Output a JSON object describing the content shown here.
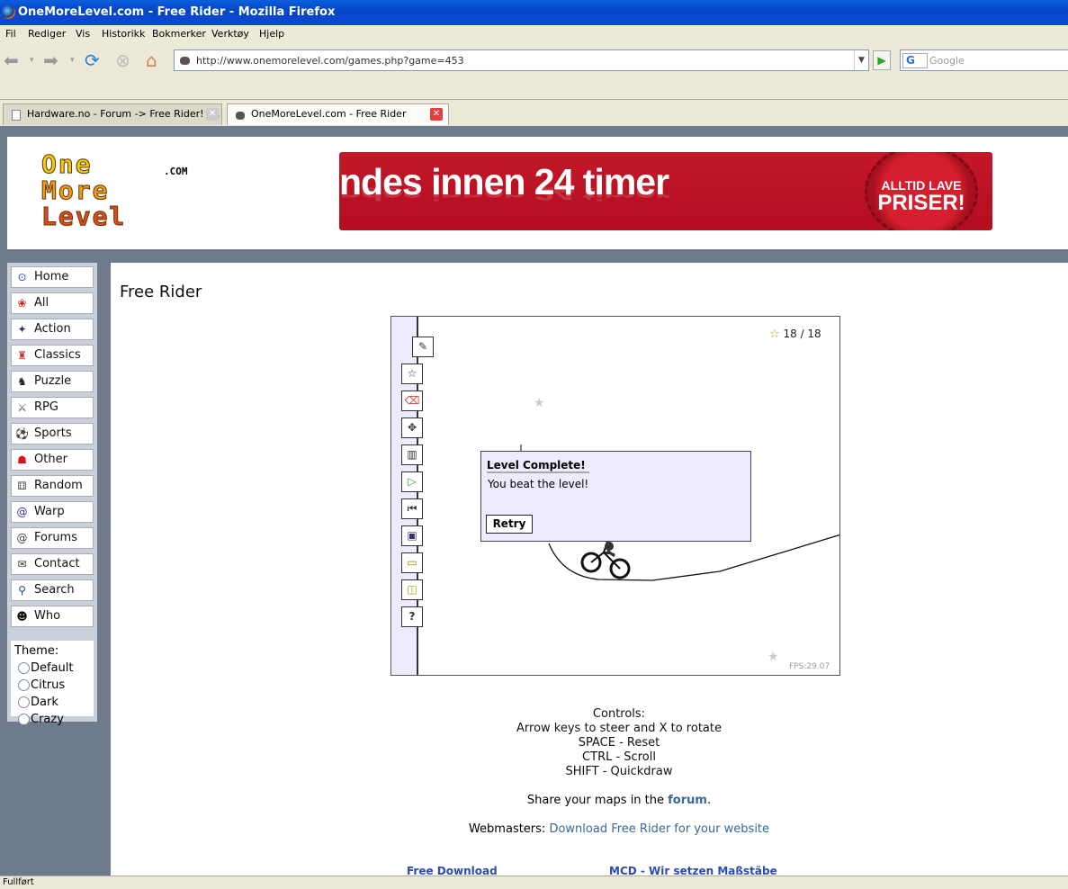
{
  "window": {
    "title": "OneMoreLevel.com - Free Rider - Mozilla Firefox"
  },
  "menubar": [
    "Fil",
    "Rediger",
    "Vis",
    "Historikk",
    "Bokmerker",
    "Verktøy",
    "Hjelp"
  ],
  "nav": {
    "url": "http://www.onemorelevel.com/games.php?game=453",
    "search_placeholder": "Google",
    "search_engine": "G"
  },
  "tabs": [
    {
      "label": "Hardware.no - Forum -> Free Rider! -...",
      "active": false
    },
    {
      "label": "OneMoreLevel.com - Free Rider",
      "active": true
    }
  ],
  "site": {
    "logo": [
      "One",
      "More",
      "Level"
    ],
    "logo_suffix": ".COM",
    "banner_text": "ndes innen 24 timer",
    "banner_badge_line1": "ALLTID LAVE",
    "banner_badge_line2": "PRISER!"
  },
  "sidebar": {
    "items": [
      {
        "label": "Home",
        "icon": "home-icon",
        "glyph": "⊙",
        "color": "#2244cc"
      },
      {
        "label": "All",
        "icon": "cherry-icon",
        "glyph": "❀",
        "color": "#c21"
      },
      {
        "label": "Action",
        "icon": "action-icon",
        "glyph": "✦",
        "color": "#335"
      },
      {
        "label": "Classics",
        "icon": "classics-icon",
        "glyph": "♜",
        "color": "#c33"
      },
      {
        "label": "Puzzle",
        "icon": "puzzle-icon",
        "glyph": "♞",
        "color": "#222"
      },
      {
        "label": "RPG",
        "icon": "sword-icon",
        "glyph": "⚔",
        "color": "#555"
      },
      {
        "label": "Sports",
        "icon": "ball-icon",
        "glyph": "⚽",
        "color": "#222"
      },
      {
        "label": "Other",
        "icon": "ghost-icon",
        "glyph": "☗",
        "color": "#d11"
      },
      {
        "label": "Random",
        "icon": "dice-icon",
        "glyph": "⚅",
        "color": "#555"
      },
      {
        "label": "Warp",
        "icon": "spiral-icon",
        "glyph": "@",
        "color": "#33a"
      },
      {
        "label": "Forums",
        "icon": "forum-icon",
        "glyph": "@",
        "color": "#444"
      },
      {
        "label": "Contact",
        "icon": "envelope-icon",
        "glyph": "✉",
        "color": "#333"
      },
      {
        "label": "Search",
        "icon": "magnifier-icon",
        "glyph": "⚲",
        "color": "#247"
      },
      {
        "label": "Who",
        "icon": "person-icon",
        "glyph": "☻",
        "color": "#111"
      }
    ],
    "theme_label": "Theme:",
    "themes": [
      "Default",
      "Citrus",
      "Dark",
      "Crazy"
    ]
  },
  "main": {
    "title": "Free Rider"
  },
  "game": {
    "stars": "18 / 18",
    "fps": "FPS:29.07",
    "dialog_title": "Level Complete!",
    "dialog_message": "You beat the level!",
    "retry_label": "Retry"
  },
  "info": {
    "controls_lines": [
      "Controls:",
      "Arrow keys to steer and X to rotate",
      "SPACE - Reset",
      "CTRL - Scroll",
      "SHIFT - Quickdraw"
    ],
    "share_prefix": "Share your maps in the ",
    "share_link": "forum",
    "share_suffix": ".",
    "webmasters_prefix": "Webmasters: ",
    "webmasters_link": "Download Free Rider for your website",
    "footer_links": [
      "Free Download",
      "MCD - Wir setzen Maßstäbe"
    ]
  },
  "status": {
    "text": "Fullført"
  },
  "colors": {
    "xp_blue": "#0a5fdc",
    "site_frame": "#6e7b8d",
    "banner_red": "#c3182a",
    "link": "#36689c"
  }
}
